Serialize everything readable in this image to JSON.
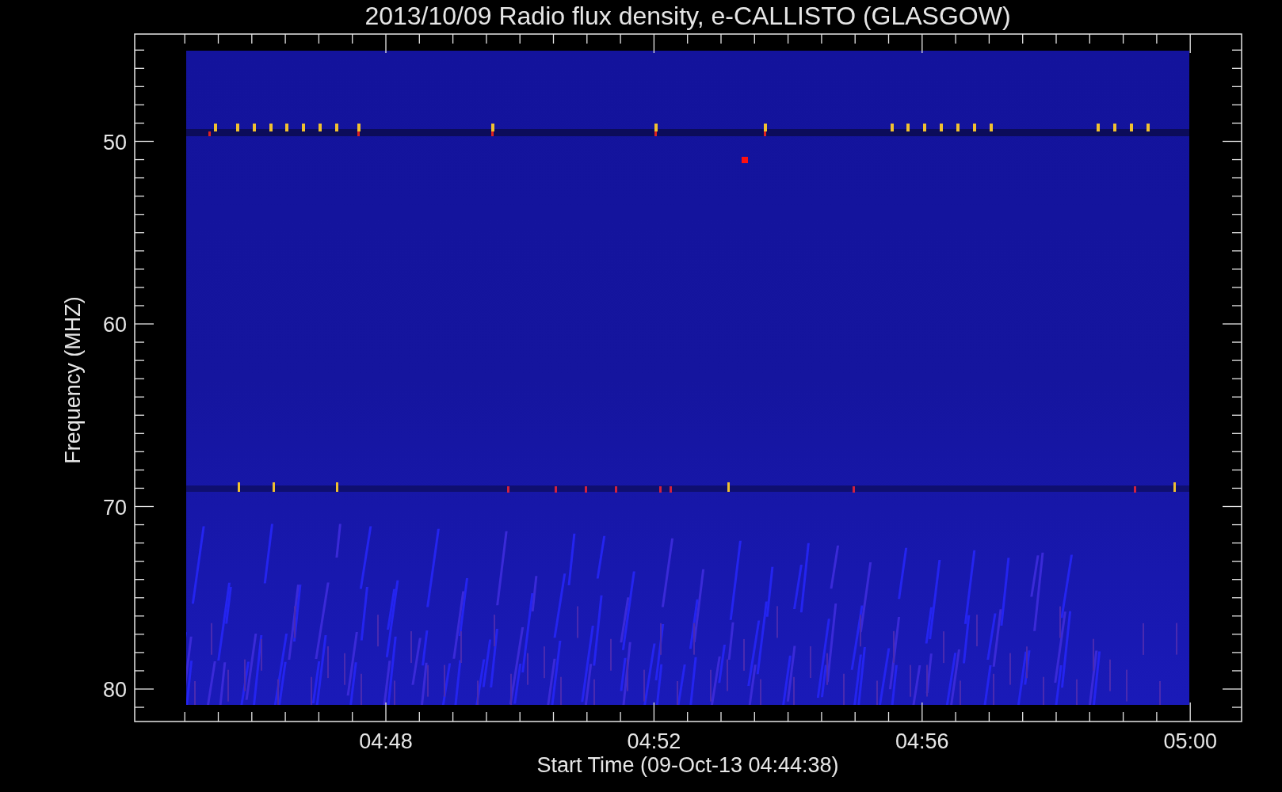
{
  "plot": {
    "title": "2013/10/09  Radio flux density, e-CALLISTO (GLASGOW)",
    "ylabel": "Frequency (MHZ)",
    "xlabel": "Start Time (09-Oct-13 04:44:38)",
    "yticks": [
      "50",
      "60",
      "70",
      "80"
    ],
    "xticks": [
      "04:48",
      "04:52",
      "04:56",
      "05:00"
    ]
  }
}
